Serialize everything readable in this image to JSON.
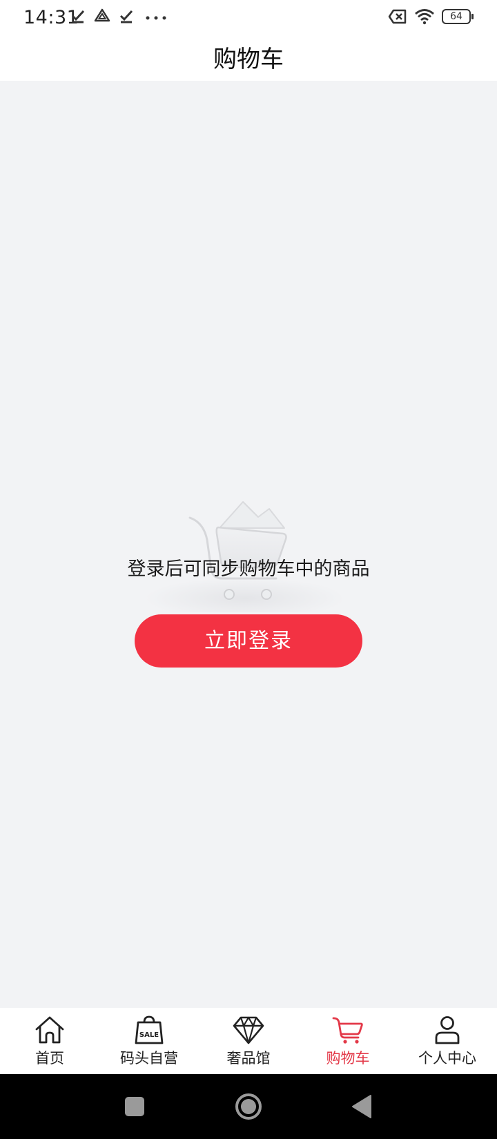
{
  "status_bar": {
    "time": "14:31",
    "battery": "64",
    "left_icons": [
      "check-icon",
      "drive-icon",
      "check-icon",
      "more-dots-icon"
    ],
    "right_icons": [
      "sim-off-icon",
      "wifi-icon",
      "battery-icon"
    ]
  },
  "header": {
    "title": "购物车"
  },
  "empty_state": {
    "illustration": "empty-cart-illustration",
    "message": "登录后可同步购物车中的商品",
    "login_button": "立即登录"
  },
  "tab_bar": {
    "items": [
      {
        "label": "首页",
        "icon": "home-icon",
        "active": false
      },
      {
        "label": "码头自营",
        "icon": "sale-bag-icon",
        "active": false
      },
      {
        "label": "奢品馆",
        "icon": "diamond-icon",
        "active": false
      },
      {
        "label": "购物车",
        "icon": "cart-icon",
        "active": true
      },
      {
        "label": "个人中心",
        "icon": "user-icon",
        "active": false
      }
    ],
    "sale_badge": "SALE",
    "active_color": "#e33848",
    "inactive_color": "#222222"
  },
  "nav_bar": {
    "buttons": [
      "recent-apps-button",
      "home-button",
      "back-button"
    ]
  },
  "colors": {
    "accent": "#f33243",
    "background": "#f2f3f5"
  }
}
